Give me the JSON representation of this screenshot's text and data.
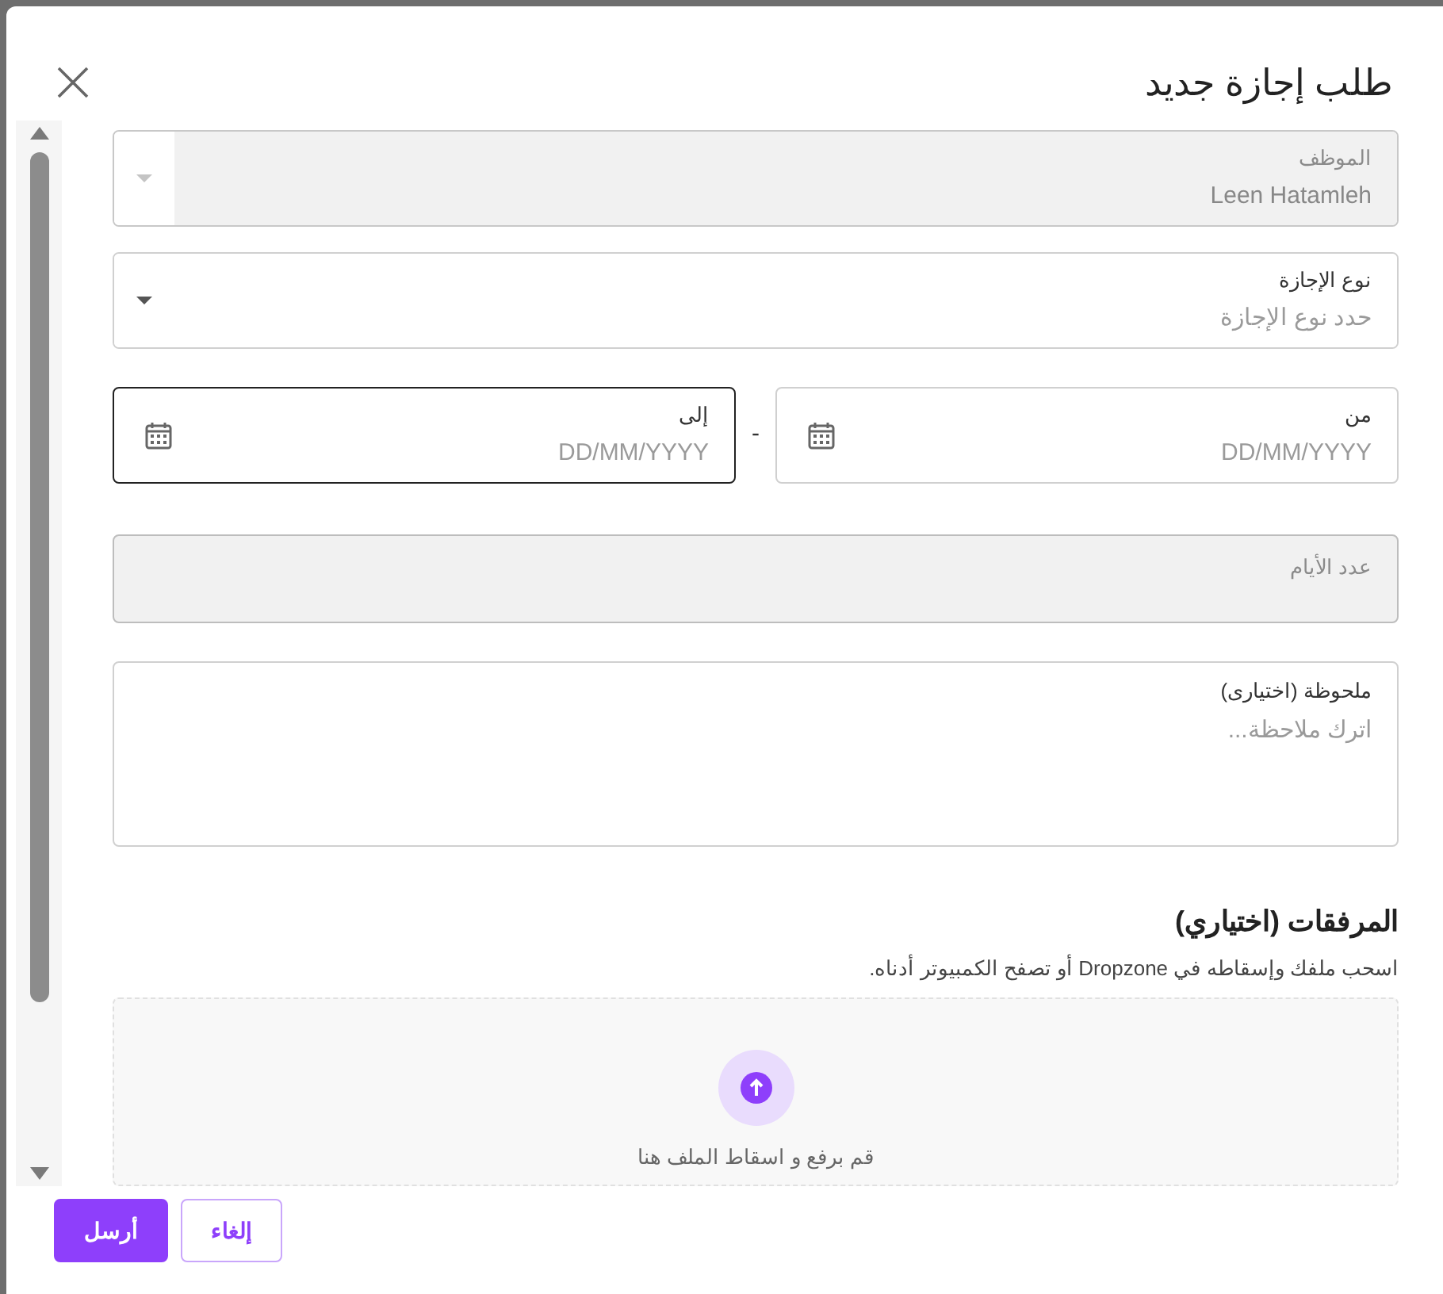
{
  "dialog": {
    "title": "طلب إجازة جديد"
  },
  "selects": [
    {
      "label": "الموظف",
      "value": "Leen Hatamleh",
      "disabled": true
    },
    {
      "label": "نوع الإجازة",
      "placeholder": "حدد نوع الإجازة",
      "disabled": false
    }
  ],
  "date_range": {
    "separator": "-",
    "dates": [
      {
        "label": "من",
        "placeholder": "DD/MM/YYYY",
        "focused": false
      },
      {
        "label": "إلى",
        "placeholder": "DD/MM/YYYY",
        "focused": true
      }
    ]
  },
  "days": {
    "label": "عدد الأيام",
    "disabled": true
  },
  "note": {
    "label": "ملحوظة (اختيارى)",
    "placeholder": "اترك ملاحظة..."
  },
  "attachments": {
    "title": "المرفقات (اختياري)",
    "hint": "اسحب ملفك وإسقاطه في Dropzone أو تصفح الكمبيوتر أدناه.",
    "dropzone_text": "قم برفع و اسقاط الملف هنا"
  },
  "buttons": [
    {
      "label": "إلغاء",
      "kind": "secondary"
    },
    {
      "label": "أرسل",
      "kind": "primary"
    }
  ]
}
